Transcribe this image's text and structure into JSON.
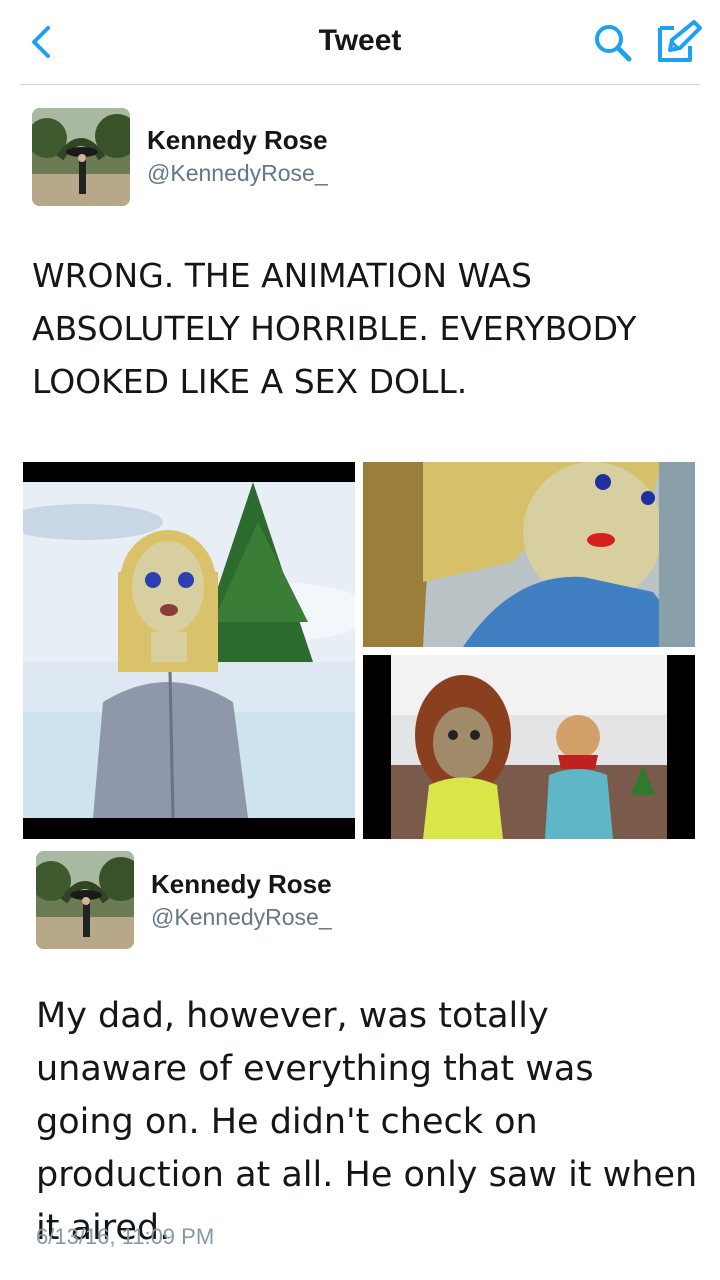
{
  "nav": {
    "title": "Tweet",
    "back_icon": "chevron-left-icon",
    "search_icon": "search-icon",
    "compose_icon": "compose-icon",
    "accent_color": "#1da1f2"
  },
  "tweets": [
    {
      "name": "Kennedy Rose",
      "handle": "@KennedyRose_",
      "text": "WRONG. THE ANIMATION WAS ABSOLUTELY HORRIBLE. EVERYBODY LOOKED LIKE A SEX DOLL.",
      "media_count": 3
    },
    {
      "name": "Kennedy Rose",
      "handle": "@KennedyRose_",
      "text": "My dad, however, was totally unaware of everything that was going on. He didn't check on production at all. He only saw it when it aired.",
      "timestamp": "6/13/16, 11:09 PM"
    }
  ]
}
